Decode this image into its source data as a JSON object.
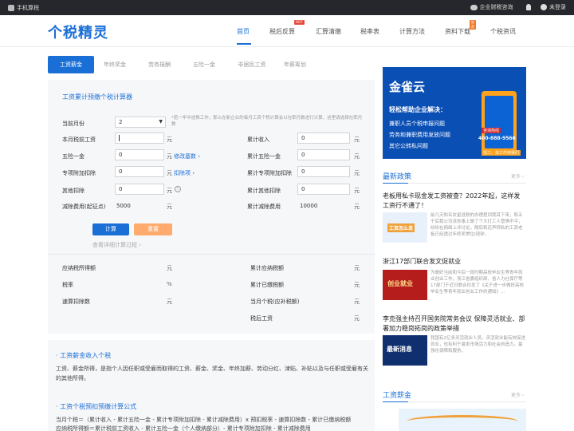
{
  "topbar": {
    "left": "手机算税",
    "consult": "企业财税咨询",
    "login": "未登录"
  },
  "header": {
    "logo": "个税精灵"
  },
  "nav": [
    {
      "label": "首页",
      "active": true
    },
    {
      "label": "税后反算",
      "badge": "HOT"
    },
    {
      "label": "汇算清缴"
    },
    {
      "label": "税率表"
    },
    {
      "label": "计算方法"
    },
    {
      "label": "资料下载",
      "badge": "推荐"
    },
    {
      "label": "个税资讯"
    }
  ],
  "tabs": [
    "工资薪金",
    "年终奖金",
    "劳务报酬",
    "五险一金",
    "非居民工资",
    "年薪筹划"
  ],
  "calc": {
    "title": "工资累计预缴个税计算器",
    "month_label": "当前月份",
    "month_value": "2",
    "note": "*若一年中途换工作，那么在新企业的每月工资个税计算会以在职月数进行计算，这里请选择在职月数",
    "salary_label": "本月税前工资",
    "salary_value": "",
    "ins_label": "五险一金",
    "ins_value": "0",
    "special_label": "专项附加扣除",
    "special_value": "0",
    "other_label": "其他扣除",
    "other_value": "0",
    "threshold_label": "减除费用(起征点)",
    "threshold_value": "5000",
    "unit": "元",
    "edit_base": "修改基数 ›",
    "deduct_items": "扣除项 ›",
    "info": "i",
    "cum_income_label": "累计收入",
    "cum_income_value": "0",
    "cum_ins_label": "累计五险一金",
    "cum_ins_value": "0",
    "cum_special_label": "累计专项附加扣除",
    "cum_special_value": "0",
    "cum_other_label": "累计其他扣除",
    "cum_other_value": "0",
    "cum_threshold_label": "累计减除费用",
    "cum_threshold_value": "10000",
    "btn_calc": "计算",
    "btn_reset": "重置",
    "hint": "查看详细计算过程 ›"
  },
  "results": {
    "taxable": "应纳税所得额",
    "rate": "税率",
    "quick": "速算扣除数",
    "cum_taxable": "累计应纳税额",
    "cum_paid": "累计已缴税额",
    "month_tax": "当月个税(应补税额)",
    "after_tax": "税后工资",
    "unit_yuan": "元",
    "unit_pct": "%"
  },
  "info": {
    "h1": "· 工资薪金收入个税",
    "p1": "工资、薪金所得，是指个人因任职或受雇而取得的工资、薪金、奖金、年终加薪、劳动分红、津贴、补贴以及与任职或受雇有关的其他所得。",
    "h2": "· 工资个税预扣预缴计算公式",
    "p2": "当月个税＝（累计收入 - 累计五险一金 - 累计专项附加扣除 - 累计减除费用）x 预扣税率 - 速算扣除数 - 累计已缴纳税额",
    "p3": "应纳税所得额＝累计税前工资收入 - 累计五险一金（个人缴纳部分）- 累计专项附加扣除 - 累计减除费用"
  },
  "ad": {
    "title": "金雀云",
    "sub": "轻松帮助企业解决：",
    "l1": "兼职人员个税申报问题",
    "l2": "劳务和兼职费用发放问题",
    "l3": "其它公转私问题",
    "tag1": "咨询热线",
    "phone": "400-888-9566",
    "tag2": "招工、找工作用我们"
  },
  "news": {
    "heading": "最新政策",
    "more": "更多 ›",
    "items": [
      {
        "title": "老板用私卡现金发工资被查？2022年起，这样发工资行不通了！",
        "desc": "前几天知名女星逃税的办理捏到我耳下来，和五千后我公司该你事上做了个大打工人管惧不平，纷纷在网络上评讨论，随后和还声称私的工资老板已经透过年终奖惨住I现钟…",
        "thumb": "工资怎么发"
      },
      {
        "title": "浙江17部门联合发文促就业",
        "desc": "为做好当前和今后一段时期高校毕业生等青年就业创业工作，浙江省委组织部、省人力社保厅等17部门于近日联合印发了《关于进一步做好高校毕业生等青年就业创业工作的通知》…",
        "thumb": "创业就业"
      },
      {
        "title": "李克强主持召开国务院常务会议 保障灵活就业、部署加力稳岗拓岗的政策举措",
        "desc": "我国有2亿多灵活就业人员。灵活就业能有效促进就业，也有利于激发市场活力和社会创造力。最强化保障和服务。",
        "thumb": "最新消息"
      }
    ]
  },
  "salary_section": {
    "heading": "工资薪金",
    "more": "更多 ›"
  }
}
